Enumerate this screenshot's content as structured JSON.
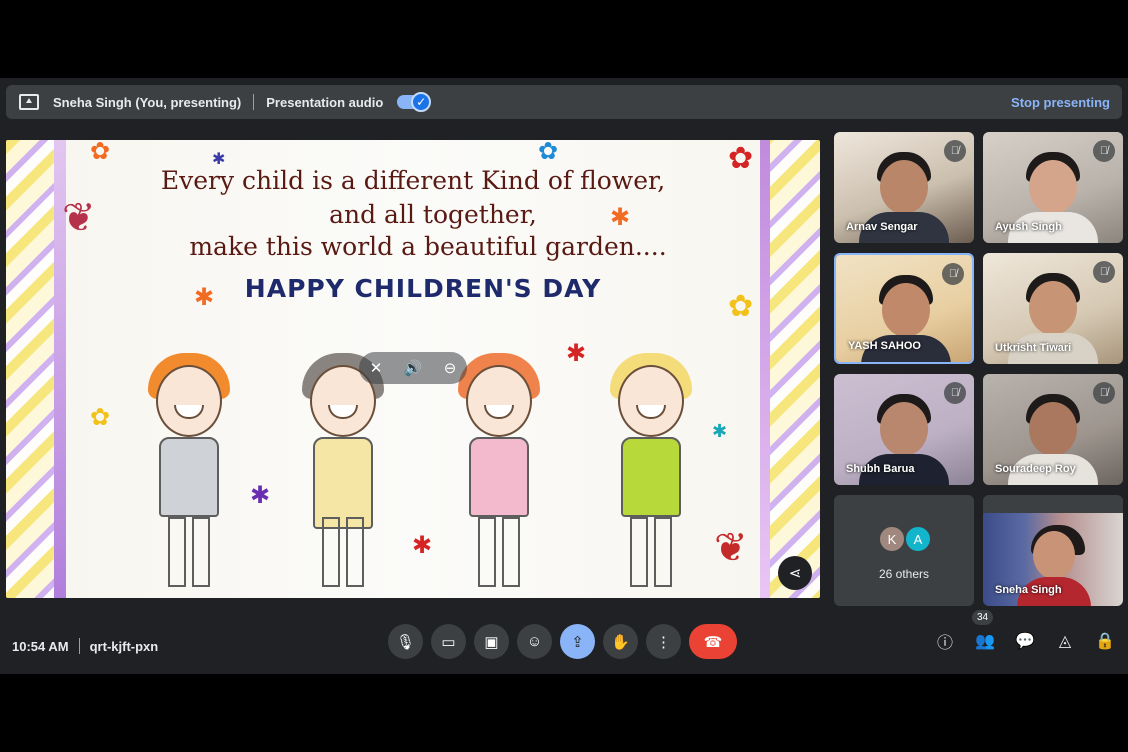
{
  "banner": {
    "presenter": "Sneha Singh (You, presenting)",
    "audio_label": "Presentation audio",
    "audio_on": true,
    "stop_label": "Stop presenting"
  },
  "slide": {
    "line1": "Every child is a different Kind of flower,",
    "line2": "and all together,",
    "line3": "make this world a beautiful garden....",
    "headline": "HAPPY CHILDREN'S DAY"
  },
  "participants": [
    {
      "name": "Arnav Sengar",
      "muted": true
    },
    {
      "name": "Ayush Singh",
      "muted": true
    },
    {
      "name": "YASH SAHOO",
      "muted": true,
      "active": true
    },
    {
      "name": "Utkrisht Tiwari",
      "muted": true
    },
    {
      "name": "Shubh Barua",
      "muted": true
    },
    {
      "name": "Souradeep Roy",
      "muted": true
    },
    {
      "name": "Sneha Singh",
      "muted": false
    }
  ],
  "others": {
    "label": "26 others",
    "avatars": [
      {
        "letter": "K",
        "color": "#a1887f"
      },
      {
        "letter": "A",
        "color": "#12b5cb"
      }
    ]
  },
  "meeting": {
    "time": "10:54 AM",
    "code": "qrt-kjft-pxn",
    "people_count": "34"
  },
  "colors": {
    "accent": "#8ab4f8",
    "end_call": "#ea4335"
  }
}
